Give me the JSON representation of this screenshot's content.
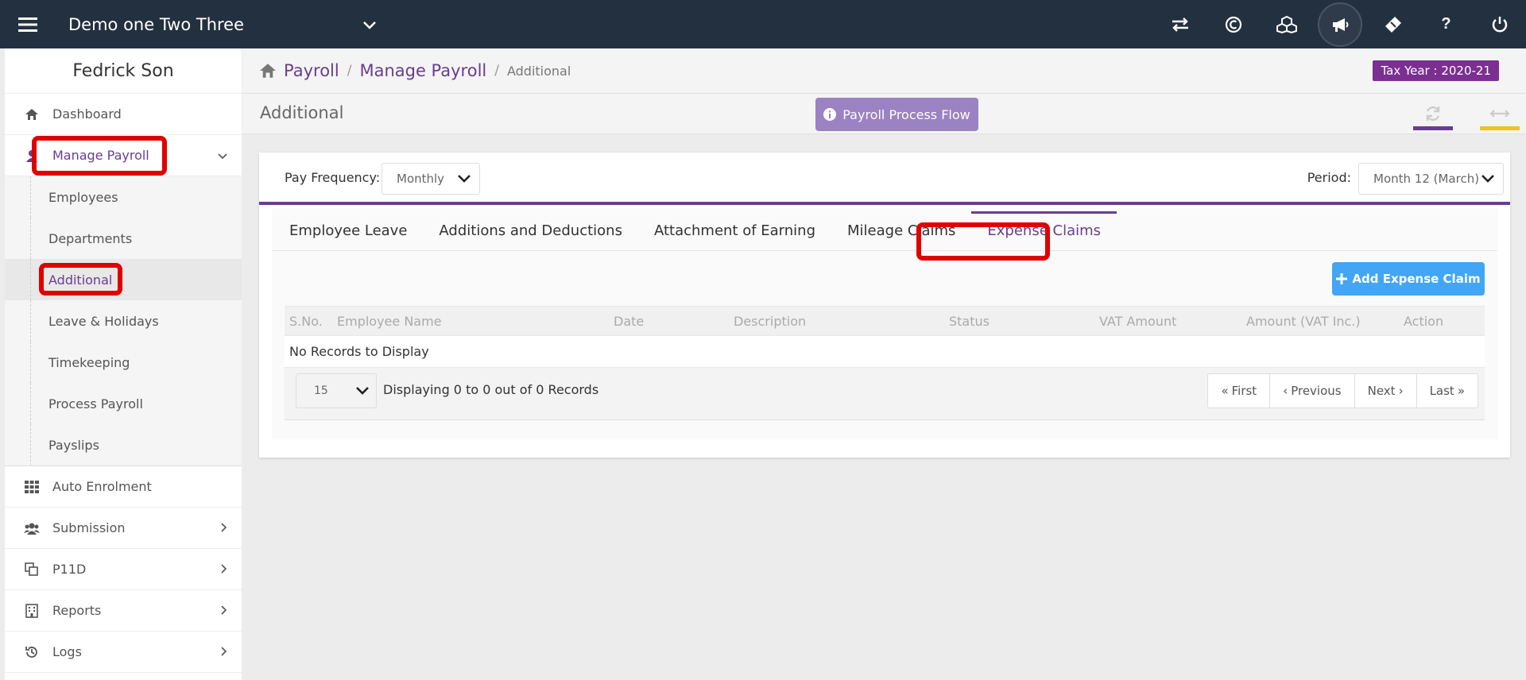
{
  "topbar": {
    "company": "Demo one Two Three",
    "icons": [
      "swap-icon",
      "currency-icon",
      "cubes-icon",
      "megaphone-icon",
      "ticket-icon",
      "help-icon",
      "power-icon"
    ]
  },
  "sidebar": {
    "user_name": "Fedrick Son",
    "dashboard": "Dashboard",
    "manage_payroll": "Manage Payroll",
    "submenu": [
      "Employees",
      "Departments",
      "Additional",
      "Leave & Holidays",
      "Timekeeping",
      "Process Payroll",
      "Payslips"
    ],
    "auto_enrolment": "Auto Enrolment",
    "submission": "Submission",
    "p11d": "P11D",
    "reports": "Reports",
    "logs": "Logs"
  },
  "breadcrumb": {
    "payroll": "Payroll",
    "manage_payroll": "Manage Payroll",
    "current": "Additional",
    "sep": "/"
  },
  "tax_year": "Tax Year : 2020-21",
  "page_title": "Additional",
  "flow_button": "Payroll Process Flow",
  "filters": {
    "pay_frequency_label": "Pay Frequency:",
    "pay_frequency_value": "Monthly",
    "period_label": "Period:",
    "period_value": "Month 12 (March)"
  },
  "tabs": [
    "Employee Leave",
    "Additions and Deductions",
    "Attachment of Earning",
    "Mileage Claims",
    "Expense Claims"
  ],
  "active_tab": "Expense Claims",
  "add_button": "Add Expense Claim",
  "table": {
    "columns": [
      "S.No.",
      "Employee Name",
      "Date",
      "Description",
      "Status",
      "VAT Amount",
      "Amount (VAT Inc.)",
      "Action"
    ],
    "empty_text": "No Records to Display"
  },
  "pager": {
    "page_size": "15",
    "info": "Displaying 0 to 0 out of 0 Records",
    "first": "First",
    "previous": "Previous",
    "next": "Next",
    "last": "Last"
  },
  "colors": {
    "topbar": "#233040",
    "accent": "#6a3d8f",
    "tax_badge": "#7a2f91",
    "add_button": "#42a5f5",
    "highlight": "#e00000"
  }
}
